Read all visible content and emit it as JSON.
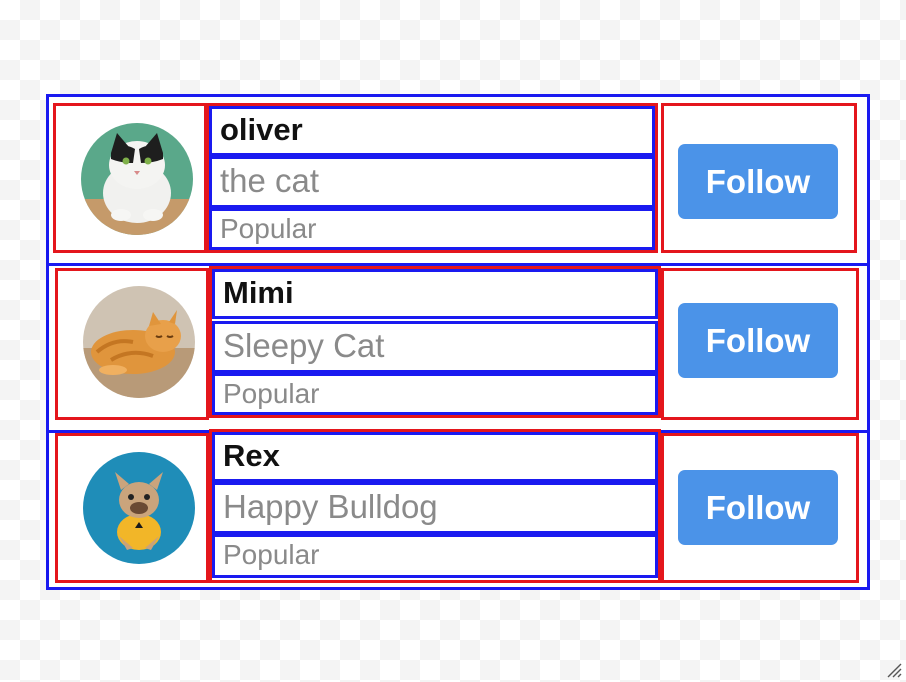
{
  "users": [
    {
      "name": "oliver",
      "subtitle": "the cat",
      "tag": "Popular",
      "follow_label": "Follow",
      "avatar_icon": "cat-tuxedo-avatar"
    },
    {
      "name": "Mimi",
      "subtitle": "Sleepy Cat",
      "tag": "Popular",
      "follow_label": "Follow",
      "avatar_icon": "cat-orange-avatar"
    },
    {
      "name": "Rex",
      "subtitle": "Happy Bulldog",
      "tag": "Popular",
      "follow_label": "Follow",
      "avatar_icon": "bulldog-avatar"
    }
  ],
  "colors": {
    "outer_border": "#1a1af0",
    "cell_border": "#e4161c",
    "text_border": "#1a1af0",
    "button_bg": "#4b93e8",
    "button_text": "#ffffff",
    "name_text": "#111111",
    "secondary_text": "#8a8a8a"
  }
}
